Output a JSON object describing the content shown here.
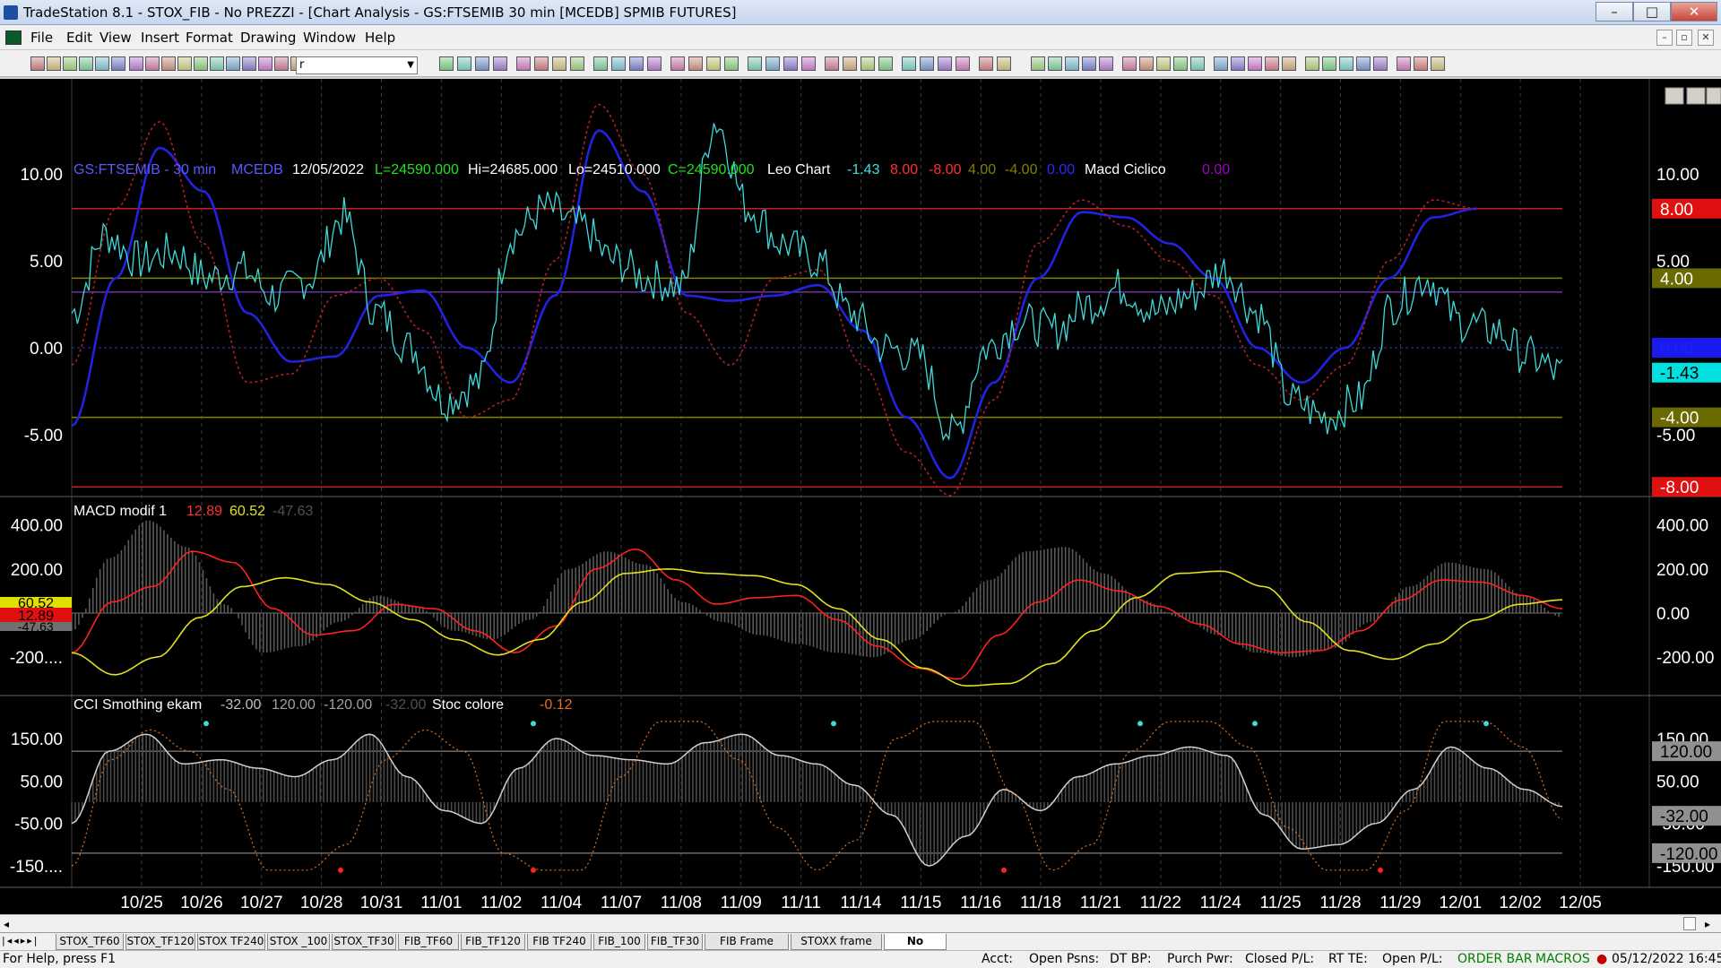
{
  "window": {
    "title": "TradeStation 8.1 - STOX_FIB - No PREZZI - [Chart Analysis - GS:FTSEMIB  30 min  [MCEDB] SPMIB FUTURES]"
  },
  "menu": [
    "File",
    "Edit",
    "View",
    "Insert",
    "Format",
    "Drawing",
    "Window",
    "Help"
  ],
  "symbol_input": "r",
  "chart": {
    "header": {
      "symbol": "GS:FTSEMIB - 30 min",
      "feed": "MCEDB",
      "date": "12/05/2022",
      "last": "L=24590.000",
      "high": "Hi=24685.000",
      "low": "Lo=24510.000",
      "close": "C=24590.000",
      "study": "Leo Chart",
      "v1": "-1.43",
      "v2": "8.00",
      "v3": "-8.00",
      "v4": "4.00",
      "v5": "-4.00",
      "v6": "0.00",
      "study2": "Macd Ciclico",
      "v7": "0.00"
    },
    "price_axis": [
      "10.00",
      "5.00",
      "0.00",
      "-5.00"
    ],
    "price_tags": {
      "p8": "8.00",
      "p4": "4.00",
      "p0": "0.00",
      "pcur": "-1.43",
      "m4": "-4.00",
      "m5": "-5.00",
      "m8": "-8.00",
      "top10": "10.00",
      "top5": "5.00"
    },
    "macd": {
      "label": "MACD modif 1",
      "v1": "12.89",
      "v2": "60.52",
      "v3": "-47.63",
      "axis": [
        "400.00",
        "200.00",
        "0.00",
        "-200.00"
      ],
      "left_axis": [
        "400.00",
        "200.00",
        "-200...."
      ],
      "left_tags": {
        "yellow": "60.52",
        "red": "12.89",
        "gray": "-47.63"
      }
    },
    "cci": {
      "label": "CCI Smothing ekam",
      "v1": "-32.00",
      "v2": "120.00",
      "v3": "-120.00",
      "v4": "-32.00",
      "label2": "Stoc colore",
      "v5": "-0.12",
      "axis": [
        "150.00",
        "50.00",
        "-50.00",
        "-150.00"
      ],
      "left_axis": [
        "150.00",
        "50.00",
        "-50.00",
        "-150...."
      ],
      "tags": {
        "t120": "120.00",
        "tm32": "-32.00",
        "tm120": "-120.00"
      }
    },
    "dates": [
      "10/25",
      "10/26",
      "10/27",
      "10/28",
      "10/31",
      "11/01",
      "11/02",
      "11/04",
      "11/07",
      "11/08",
      "11/09",
      "11/11",
      "11/14",
      "11/15",
      "11/16",
      "11/18",
      "11/21",
      "11/22",
      "11/24",
      "11/25",
      "11/28",
      "11/29",
      "12/01",
      "12/02",
      "12/05"
    ]
  },
  "tabs": [
    "STOX_TF60",
    "STOX_TF120",
    "STOX TF240",
    "STOX _100",
    "STOX_TF30",
    "FIB_TF60",
    "FIB_TF120",
    "FIB TF240",
    "FIB_100",
    "FIB_TF30",
    "FIB Frame bassi",
    "STOXX frame bassi",
    "No PREZZI"
  ],
  "status": {
    "help": "For Help, press F1",
    "acct": "Acct:",
    "open_psns": "Open Psns:",
    "dt_bp": "DT BP:",
    "purch_pwr": "Purch Pwr:",
    "closed_pl": "Closed P/L:",
    "rt_te": "RT TE:",
    "open_pl": "Open P/L:",
    "order_bar": "ORDER BAR",
    "macros": "MACROS",
    "datetime": "05/12/2022 16:45"
  },
  "colors": {
    "bg": "#000000",
    "cyan": "#40d8d8",
    "blue": "#2222e0",
    "red": "#ff2020",
    "darkred": "#b02020",
    "olive": "#808000",
    "purple": "#8000a0",
    "yellow": "#e0e020",
    "grey": "#888888"
  }
}
